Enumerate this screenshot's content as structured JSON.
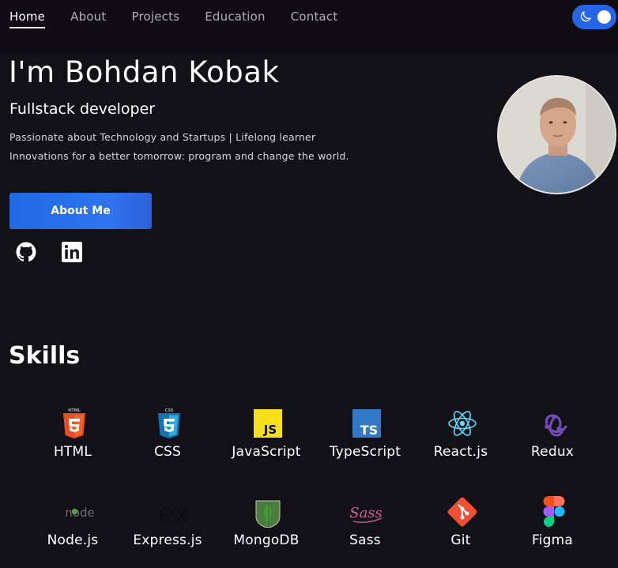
{
  "nav": {
    "items": [
      {
        "label": "Home",
        "active": true
      },
      {
        "label": "About"
      },
      {
        "label": "Projects"
      },
      {
        "label": "Education"
      },
      {
        "label": "Contact"
      }
    ],
    "theme_toggle": {
      "icon": "moon-icon",
      "state": "dark"
    }
  },
  "hero": {
    "name": "I'm Bohdan Kobak",
    "role": "Fullstack developer",
    "line1": "Passionate about Technology and Startups | Lifelong learner",
    "line2": "Innovations for a better tomorrow: program and change the world.",
    "button": "About Me",
    "social": [
      {
        "icon": "github-icon"
      },
      {
        "icon": "linkedin-icon"
      }
    ]
  },
  "skills": {
    "title": "Skills",
    "items": [
      {
        "label": "HTML",
        "icon": "html5-icon"
      },
      {
        "label": "CSS",
        "icon": "css3-icon"
      },
      {
        "label": "JavaScript",
        "icon": "javascript-icon"
      },
      {
        "label": "TypeScript",
        "icon": "typescript-icon"
      },
      {
        "label": "React.js",
        "icon": "react-icon"
      },
      {
        "label": "Redux",
        "icon": "redux-icon"
      },
      {
        "label": "Node.js",
        "icon": "nodejs-icon"
      },
      {
        "label": "Express.js",
        "icon": "express-icon"
      },
      {
        "label": "MongoDB",
        "icon": "mongodb-icon"
      },
      {
        "label": "Sass",
        "icon": "sass-icon"
      },
      {
        "label": "Git",
        "icon": "git-icon"
      },
      {
        "label": "Figma",
        "icon": "figma-icon"
      }
    ]
  },
  "colors": {
    "background": "#131118",
    "accent": "#2466e6"
  }
}
